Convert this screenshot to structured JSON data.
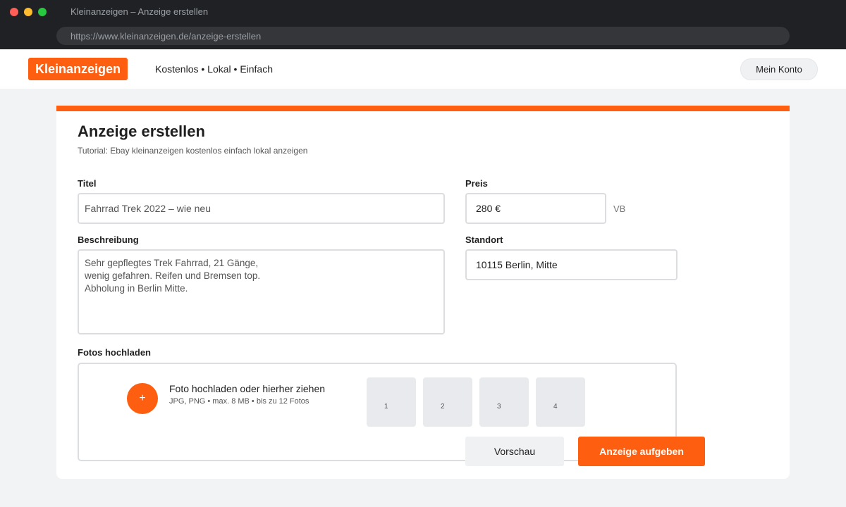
{
  "window": {
    "title": "Kleinanzeigen – Anzeige erstellen",
    "url": "https://www.kleinanzeigen.de/anzeige-erstellen"
  },
  "header": {
    "logo": "Kleinanzeigen",
    "tagline": "Kostenlos • Lokal • Einfach",
    "account_label": "Mein Konto"
  },
  "form": {
    "heading": "Anzeige erstellen",
    "subtitle": "Tutorial: Ebay kleinanzeigen kostenlos einfach lokal anzeigen",
    "title_label": "Titel",
    "title_value": "Fahrrad Trek 2022 – wie neu",
    "price_label": "Preis",
    "price_value": "280 €",
    "price_suffix": "VB",
    "description_label": "Beschreibung",
    "description_value": "Sehr gepflegtes Trek Fahrrad, 21 Gänge,\nwenig gefahren. Reifen und Bremsen top.\nAbholung in Berlin Mitte.",
    "location_label": "Standort",
    "location_value": "10115 Berlin, Mitte",
    "photos_label": "Fotos hochladen"
  },
  "upload": {
    "button_icon": "plus-icon",
    "button_glyph": "+",
    "title": "Foto hochladen oder hierher ziehen",
    "hint": "JPG, PNG • max. 8 MB • bis zu 12 Fotos",
    "slots": [
      "1",
      "2",
      "3",
      "4"
    ]
  },
  "actions": {
    "preview_label": "Vorschau",
    "submit_label": "Anzeige aufgeben"
  },
  "colors": {
    "brand": "#fd5e0f",
    "chrome": "#202124"
  }
}
